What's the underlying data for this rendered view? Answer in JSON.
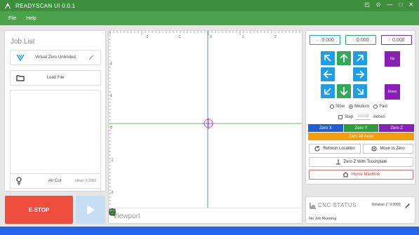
{
  "window": {
    "title": "READYSCAN UI 0.0.1",
    "controls": [
      "◰",
      "⊙",
      "—",
      "□",
      "✕"
    ]
  },
  "menu": {
    "items": [
      "File",
      "Help"
    ]
  },
  "job_panel": {
    "title": "Job List",
    "virtual_zero_label": "Virtual Zero Unlimited",
    "load_file_label": "Load File",
    "air_cut_label": "Air Cut",
    "air_cut_value": "offset: 0.2000"
  },
  "estop": {
    "label": "E-STOP"
  },
  "visualizer": {
    "x_ticks": [
      "-2",
      "-1",
      "0",
      "1",
      "2"
    ],
    "y_ticks": [
      "2",
      "1",
      "0",
      "-1",
      "-2"
    ],
    "viewport_label": "Viewport"
  },
  "jog": {
    "step_values": [
      "0.000",
      "0.000",
      "0.000"
    ],
    "up_label": "Up",
    "down_label": "Down",
    "speeds": [
      "Slow",
      "Medium",
      "Fast"
    ],
    "selected_speed": "Medium",
    "step_label": "Step",
    "step_placeholder": "0.0100",
    "step_unit": "inches",
    "zero_x": "Zero X",
    "zero_y": "Zero Y",
    "zero_z": "Zero Z",
    "zero_all": "Zero All Axes",
    "refresh_location": "Refresh Location",
    "move_to_zero": "Move to Zero",
    "zero_z_touchplate": "Zero Z With Touchplate",
    "home_machine": "Home Machine"
  },
  "status": {
    "title": "CNC STATUS",
    "z_label": "Relative Z: 0.0000",
    "job_status": "No Job Running"
  },
  "colors": {
    "titlebar": "#3d8f3d",
    "menubar": "#4da34d",
    "estop": "#ee4d3d",
    "jog_blue": "#1d9ee6",
    "jog_green": "#2eaa58",
    "jog_purple": "#8a1fb5",
    "zero_x": "#1f5fd0",
    "zero_y": "#2e9c3a",
    "zero_z": "#8a1fb5",
    "zero_all": "#f59c0b",
    "home_red": "#d33333"
  }
}
